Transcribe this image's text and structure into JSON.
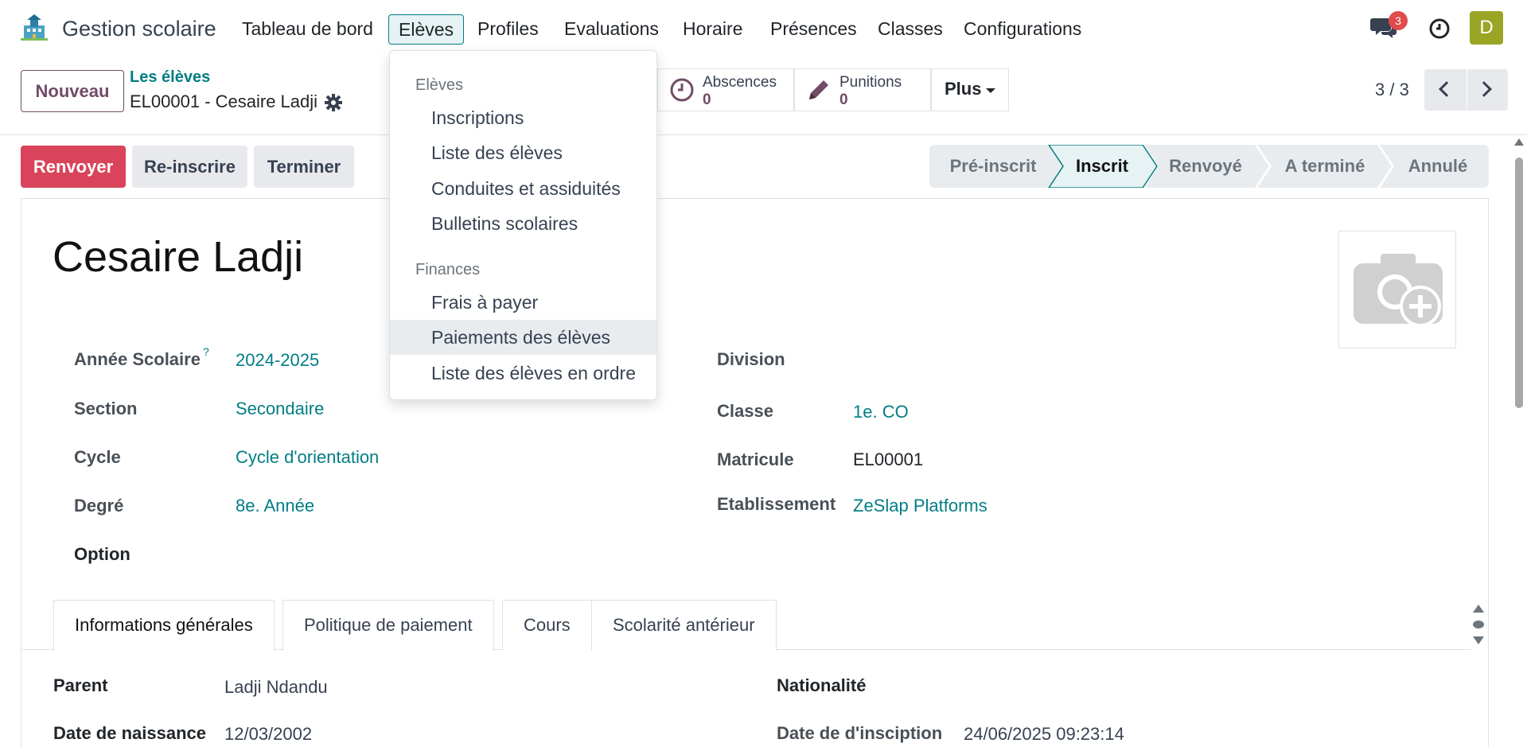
{
  "app": {
    "title": "Gestion scolaire",
    "logo_icon": "school-building-icon"
  },
  "nav": {
    "items": [
      "Tableau de bord",
      "Elèves",
      "Profiles",
      "Evaluations",
      "Horaire",
      "Présences",
      "Classes",
      "Configurations"
    ],
    "active": "Elèves"
  },
  "systray": {
    "messages_count": "3",
    "avatar_letter": "D"
  },
  "control": {
    "new_button": "Nouveau",
    "breadcrumb_parent": "Les élèves",
    "breadcrumb_current": "EL00001 - Cesaire Ladji",
    "pager": "3 / 3"
  },
  "smart_buttons": {
    "absences": {
      "label": "Abscences",
      "value": "0"
    },
    "punitions": {
      "label": "Punitions",
      "value": "0"
    },
    "more": "Plus"
  },
  "actions": {
    "renvoyer": "Renvoyer",
    "reinscrire": "Re-inscrire",
    "terminer": "Terminer"
  },
  "statusbar": {
    "stages": [
      "Pré-inscrit",
      "Inscrit",
      "Renvoyé",
      "A terminé",
      "Annulé"
    ],
    "current": "Inscrit"
  },
  "record": {
    "name": "Cesaire Ladji",
    "left_fields": [
      {
        "label": "Année Scolaire",
        "value": "2024-2025"
      },
      {
        "label": "Section",
        "value": "Secondaire"
      },
      {
        "label": "Cycle",
        "value": "Cycle d'orientation"
      },
      {
        "label": "Degré",
        "value": "8e. Année"
      },
      {
        "label": "Option",
        "value": ""
      }
    ],
    "tooltip_mark": "?",
    "right_fields": [
      {
        "label": "Division",
        "value": ""
      },
      {
        "label": "Classe",
        "value": "1e. CO"
      },
      {
        "label": "Matricule",
        "value": "EL00001"
      },
      {
        "label": "Etablissement",
        "value": "ZeSlap Platforms"
      }
    ]
  },
  "tabs": [
    "Informations générales",
    "Politique de paiement",
    "Cours",
    "Scolarité antérieur"
  ],
  "general_info": {
    "parent_label": "Parent",
    "parent_value": "Ladji Ndandu",
    "birth_label": "Date de naissance",
    "birth_value": "12/03/2002",
    "nationality_label": "Nationalité",
    "nationality_value": "",
    "inscription_label": "Date de d'insciption",
    "inscription_value": "24/06/2025 09:23:14"
  },
  "dropdown": {
    "section1": "Elèves",
    "items1": [
      "Inscriptions",
      "Liste des élèves",
      "Conduites et assiduités",
      "Bulletins scolaires"
    ],
    "section2": "Finances",
    "items2": [
      "Frais à payer",
      "Paiements des élèves",
      "Liste des élèves en ordre"
    ],
    "hovered": "Paiements des élèves"
  },
  "colors": {
    "accent": "#017e84",
    "brand": "#714b67",
    "danger": "#d9445a",
    "avatar": "#9aa525"
  }
}
